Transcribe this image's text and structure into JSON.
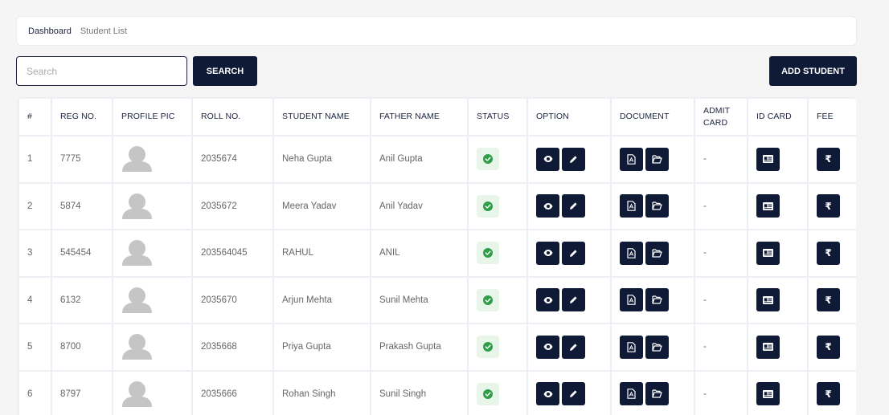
{
  "breadcrumb": {
    "home": "Dashboard",
    "current": "Student List"
  },
  "search": {
    "placeholder": "Search",
    "value": "",
    "button_label": "SEARCH"
  },
  "add_button_label": "ADD STUDENT",
  "table": {
    "headers": [
      "#",
      "REG NO.",
      "PROFILE PIC",
      "ROLL NO.",
      "STUDENT NAME",
      "FATHER NAME",
      "STATUS",
      "OPTION",
      "DOCUMENT",
      "ADMIT CARD",
      "ID CARD",
      "FEE"
    ],
    "rows": [
      {
        "idx": "1",
        "reg": "7775",
        "roll": "2035674",
        "name": "Neha Gupta",
        "father": "Anil Gupta",
        "admit": "-"
      },
      {
        "idx": "2",
        "reg": "5874",
        "roll": "2035672",
        "name": "Meera Yadav",
        "father": "Anil Yadav",
        "admit": "-"
      },
      {
        "idx": "3",
        "reg": "545454",
        "roll": "203564045",
        "name": "RAHUL",
        "father": "ANIL",
        "admit": "-"
      },
      {
        "idx": "4",
        "reg": "6132",
        "roll": "2035670",
        "name": "Arjun Mehta",
        "father": "Sunil Mehta",
        "admit": "-"
      },
      {
        "idx": "5",
        "reg": "8700",
        "roll": "2035668",
        "name": "Priya Gupta",
        "father": "Prakash Gupta",
        "admit": "-"
      },
      {
        "idx": "6",
        "reg": "8797",
        "roll": "2035666",
        "name": "Rohan Singh",
        "father": "Sunil Singh",
        "admit": "-"
      }
    ]
  },
  "icons": {
    "status": "check-circle-icon",
    "view": "eye-icon",
    "edit": "pencil-icon",
    "pdf": "pdf-file-icon",
    "folder": "folder-open-icon",
    "id_card": "id-card-icon",
    "fee": "rupee-icon",
    "fee_glyph": "₹"
  },
  "colors": {
    "primary": "#0f1a36",
    "status_green": "#2e9e48",
    "status_bg": "#e8f6ea"
  }
}
